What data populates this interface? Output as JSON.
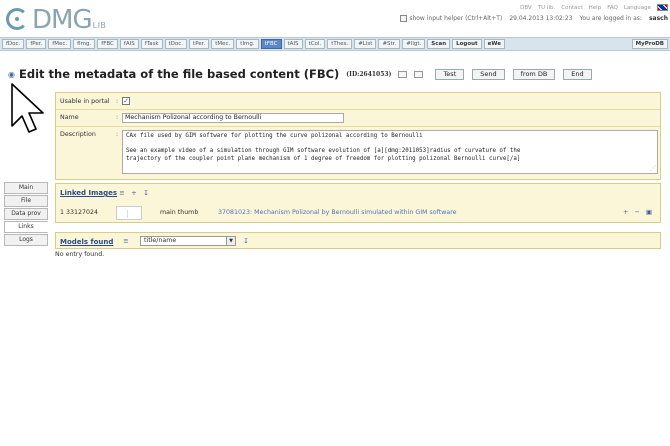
{
  "header": {
    "logo_text": "DMG",
    "logo_sub": "LIB",
    "top_links": [
      "DBV",
      "TU Ilb.",
      "Contact",
      "Help",
      "FAQ",
      "Language"
    ],
    "show_input_helper": "show input helper (Ctrl+Alt+T)",
    "datetime": "29.04.2013 13:02:23",
    "logged_in_prefix": "You are logged in as:",
    "logged_in_user": "sasch"
  },
  "toolbar": {
    "items": [
      "fDoc.",
      "fPer.",
      "fMec.",
      "fImg.",
      "fFBC",
      "fAIS",
      "fTask",
      "tDoc.",
      "tPer.",
      "tMec.",
      "tImg.",
      "tFBC",
      "tAIS",
      "tCol.",
      "tThes.",
      "#List",
      "#Str.",
      "#llgt.",
      "Scan",
      "Logout",
      "eWe"
    ],
    "active": "tFBC",
    "right_label": "MyProDB"
  },
  "title": {
    "text": "Edit the metadata of the file based content (FBC)",
    "id": "(ID:2641053)",
    "buttons": [
      "Test",
      "Send",
      "from DB",
      "End"
    ]
  },
  "form": {
    "usable_label": "Usable in portal",
    "usable_checked": true,
    "name_label": "Name",
    "name_value": "Mechanism Polizonal according to Bernoulli",
    "description_label": "Description",
    "description_value": "CAx file used by GIM software for plotting the curve polizonal according to Bernoulli\n\nSee an example video of a simulation through GIM software evolution of [a][dmg:2011053]radius of curvature of the\ntrajectory of the coupler point plane mechanism of 1 degree of freedom for plotting polizonal Bernoulli curve[/a]"
  },
  "tabs": [
    "Main",
    "File",
    "Data prov",
    "Links",
    "Logs"
  ],
  "active_tab": "Links",
  "linked_images": {
    "heading": "Linked Images",
    "rows": [
      {
        "id": "1  33127024",
        "kind": "main thumb",
        "description": "37081023: Mechanism Polizonal by Bernoulli simulated within GIM software"
      }
    ]
  },
  "models_found": {
    "heading": "Models found",
    "select_value": "title/name",
    "empty_text": "No entry found."
  }
}
